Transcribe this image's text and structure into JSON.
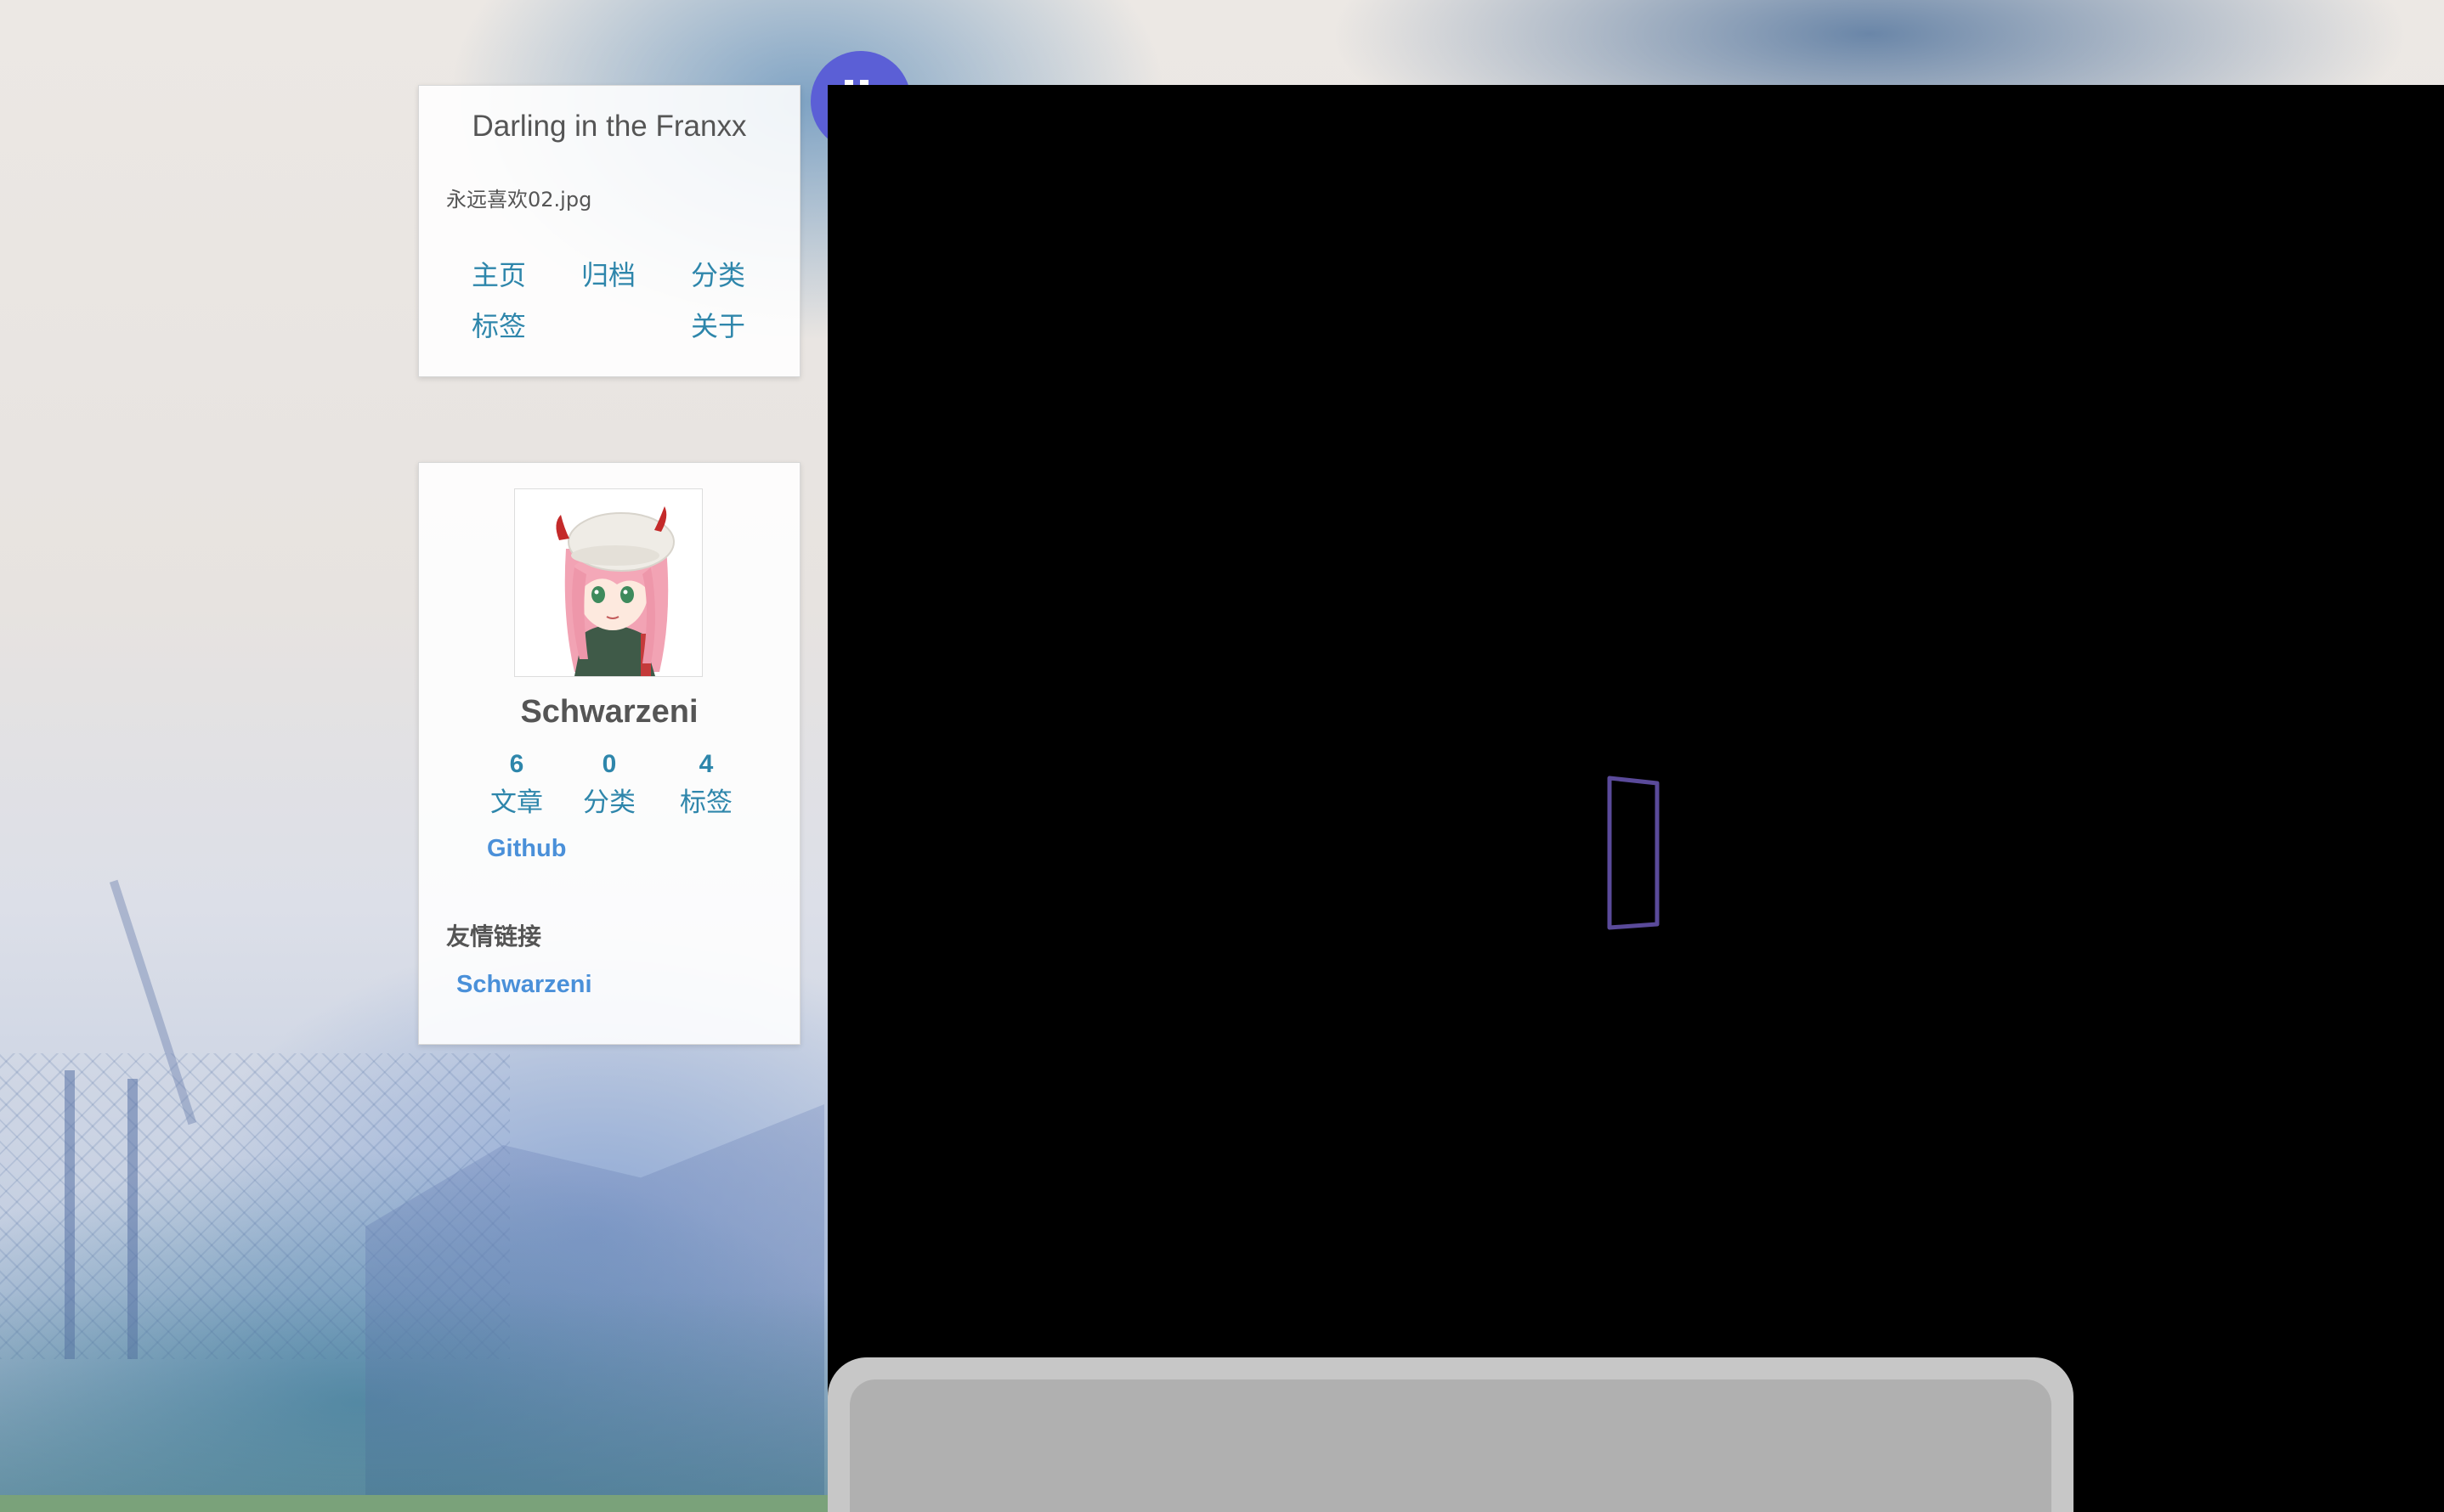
{
  "site": {
    "title": "Darling in the Franxx",
    "subtitle": "永远喜欢02.jpg"
  },
  "menu": {
    "home": "主页",
    "archives": "归档",
    "categories": "分类",
    "tags": "标签",
    "about": "关于"
  },
  "author": {
    "name": "Schwarzeni",
    "avatar": "zero-two-avatar-image"
  },
  "stats": [
    {
      "count": "6",
      "label": "文章"
    },
    {
      "count": "0",
      "label": "分类"
    },
    {
      "count": "4",
      "label": "标签"
    }
  ],
  "social": {
    "github": "Github"
  },
  "links": {
    "title": "友情链接",
    "items": [
      "Schwarzeni"
    ]
  },
  "colors": {
    "link": "#2e86ab",
    "accent_link": "#4a90d9",
    "fab": "#5b5fd6",
    "viewer_background": "#000000",
    "phone_outline": "#5a4a9a"
  },
  "icons": {
    "fab": "toggle-icon",
    "viewer_center": "phone-rotate-icon"
  }
}
